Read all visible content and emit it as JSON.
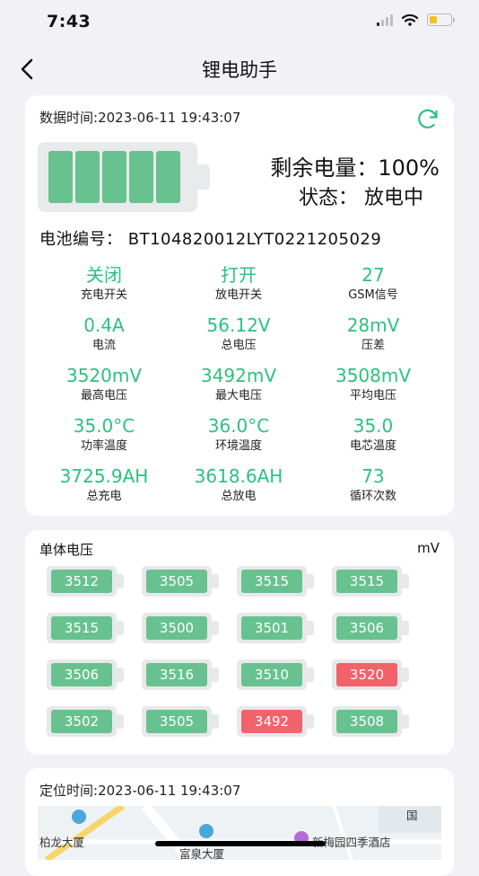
{
  "status_bar": {
    "time": "7:43"
  },
  "nav": {
    "title": "锂电助手"
  },
  "summary": {
    "data_time_label": "数据时间:",
    "data_time_value": "2023-06-11 19:43:07",
    "remain_text": "剩余电量：100%",
    "state_text": "状态：  放电中",
    "battery_no_label": "电池编号：",
    "battery_no_value": "BT104820012LYT0221205029",
    "battery_level_percent": 100,
    "accent_color": "#2cc17e"
  },
  "metrics": [
    {
      "value": "关闭",
      "label": "充电开关"
    },
    {
      "value": "打开",
      "label": "放电开关"
    },
    {
      "value": "27",
      "label": "GSM信号"
    },
    {
      "value": "0.4A",
      "label": "电流"
    },
    {
      "value": "56.12V",
      "label": "总电压"
    },
    {
      "value": "28mV",
      "label": "压差"
    },
    {
      "value": "3520mV",
      "label": "最高电压"
    },
    {
      "value": "3492mV",
      "label": "最大电压"
    },
    {
      "value": "3508mV",
      "label": "平均电压"
    },
    {
      "value": "35.0°C",
      "label": "功率温度"
    },
    {
      "value": "36.0°C",
      "label": "环境温度"
    },
    {
      "value": "35.0",
      "label": "电芯温度"
    },
    {
      "value": "3725.9AH",
      "label": "总充电"
    },
    {
      "value": "3618.6AH",
      "label": "总放电"
    },
    {
      "value": "73",
      "label": "循环次数"
    }
  ],
  "cells": {
    "title": "单体电压",
    "unit": "mV",
    "normal_color": "#68c28f",
    "alert_color": "#f2626b",
    "values": [
      {
        "v": "3512",
        "alert": false
      },
      {
        "v": "3505",
        "alert": false
      },
      {
        "v": "3515",
        "alert": false
      },
      {
        "v": "3515",
        "alert": false
      },
      {
        "v": "3515",
        "alert": false
      },
      {
        "v": "3500",
        "alert": false
      },
      {
        "v": "3501",
        "alert": false
      },
      {
        "v": "3506",
        "alert": false
      },
      {
        "v": "3506",
        "alert": false
      },
      {
        "v": "3516",
        "alert": false
      },
      {
        "v": "3510",
        "alert": false
      },
      {
        "v": "3520",
        "alert": true
      },
      {
        "v": "3502",
        "alert": false
      },
      {
        "v": "3505",
        "alert": false
      },
      {
        "v": "3492",
        "alert": true
      },
      {
        "v": "3508",
        "alert": false
      }
    ]
  },
  "location": {
    "time_label": "定位时间:",
    "time_value": "2023-06-11 19:43:07",
    "map_labels": [
      "柏龙大厦",
      "新梅园四季酒店",
      "富泉大厦",
      "国"
    ]
  }
}
